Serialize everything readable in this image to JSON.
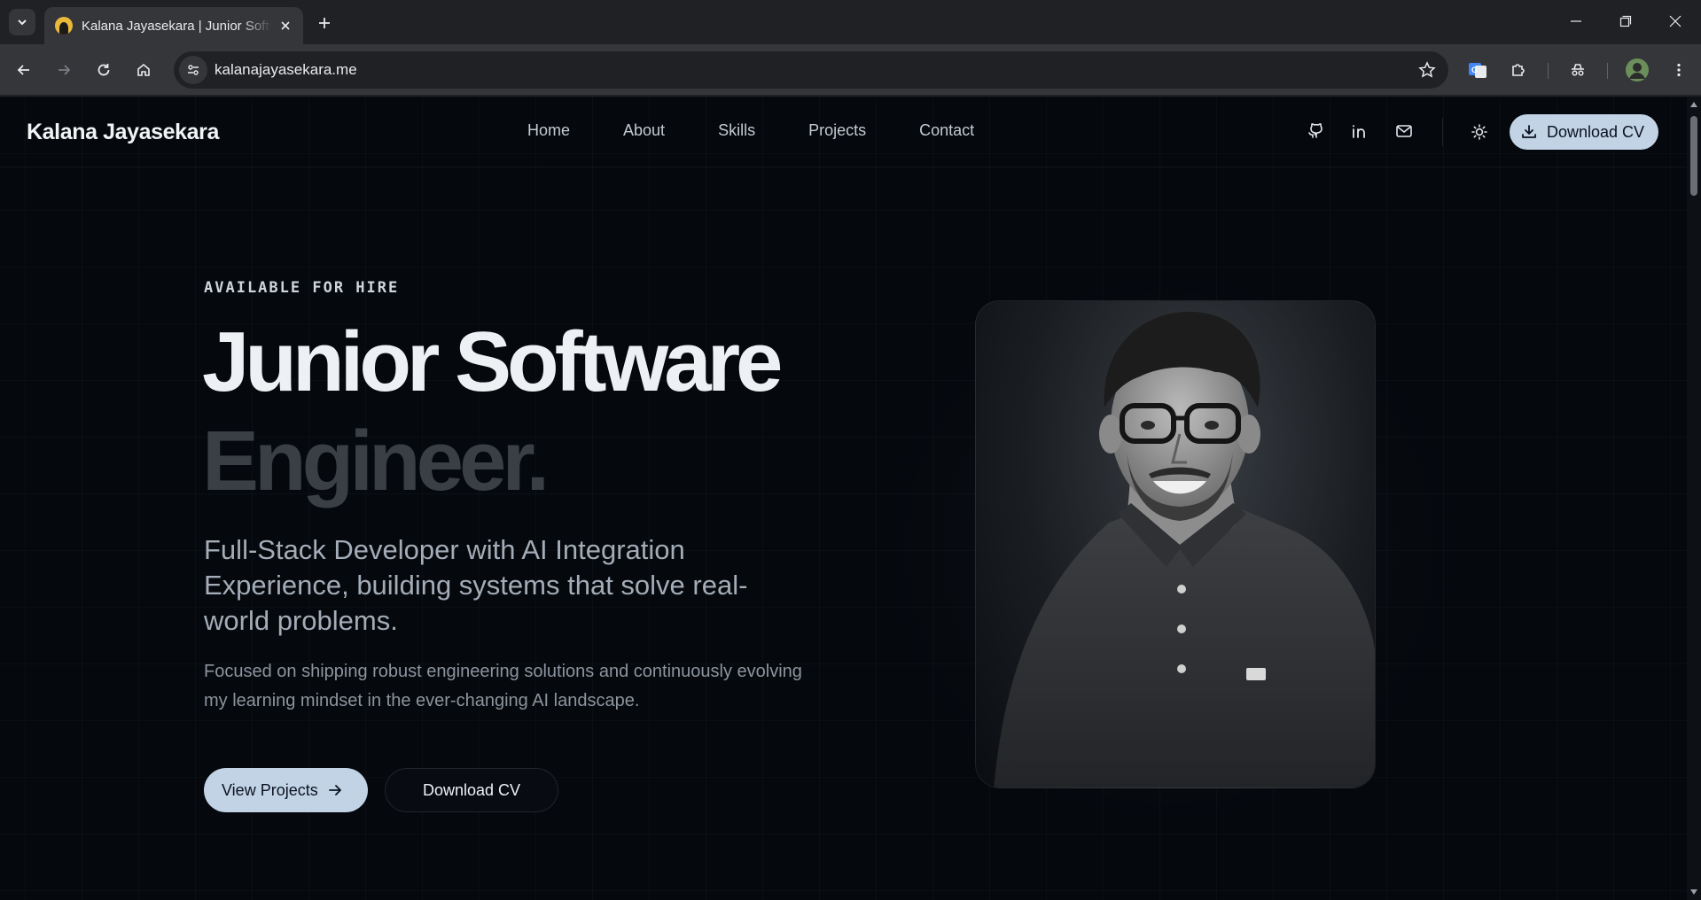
{
  "browser": {
    "tab_title": "Kalana Jayasekara | Junior Software Engineer",
    "url": "kalanajayasekara.me"
  },
  "site": {
    "brand": "Kalana Jayasekara",
    "nav": [
      "Home",
      "About",
      "Skills",
      "Projects",
      "Contact"
    ],
    "header_cv_label": "Download CV"
  },
  "hero": {
    "eyebrow": "AVAILABLE FOR HIRE",
    "headline_line1": "Junior Software",
    "headline_line2": "Engineer.",
    "subtitle": "Full-Stack Developer with AI Integration Experience, building systems that solve real-world problems.",
    "description": "Focused on shipping robust engineering solutions and continuously evolving my learning mindset in the ever-changing AI landscape.",
    "primary_cta": "View Projects",
    "secondary_cta": "Download CV"
  },
  "icons": {
    "social": [
      "github-icon",
      "linkedin-icon",
      "mail-icon"
    ],
    "theme": "sun-icon"
  },
  "colors": {
    "page_bg": "#05080d",
    "accent": "#c2d3e6",
    "headline": "#eef1f4",
    "headline_muted": "#3a3f46"
  }
}
